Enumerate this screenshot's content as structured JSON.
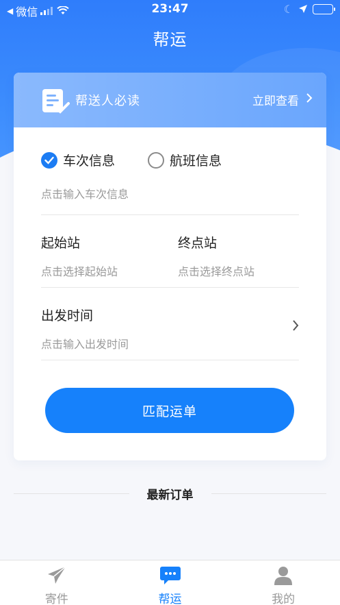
{
  "status_bar": {
    "back_app": "微信",
    "time": "23:47"
  },
  "page": {
    "title": "帮运"
  },
  "notice": {
    "title": "帮送人必读",
    "link": "立即查看"
  },
  "form": {
    "options": [
      {
        "label": "车次信息",
        "selected": true
      },
      {
        "label": "航班信息",
        "selected": false
      }
    ],
    "train_placeholder": "点击输入车次信息",
    "start_label": "起始站",
    "start_placeholder": "点击选择起始站",
    "end_label": "终点站",
    "end_placeholder": "点击选择终点站",
    "time_label": "出发时间",
    "time_placeholder": "点击输入出发时间",
    "submit_label": "匹配运单"
  },
  "latest": {
    "title": "最新订单"
  },
  "tabbar": {
    "items": [
      {
        "label": "寄件",
        "icon": "send-icon",
        "active": false
      },
      {
        "label": "帮运",
        "icon": "chat-icon",
        "active": true
      },
      {
        "label": "我的",
        "icon": "user-icon",
        "active": false
      }
    ]
  },
  "colors": {
    "accent": "#1681fb",
    "header": "#3d8dfd"
  }
}
